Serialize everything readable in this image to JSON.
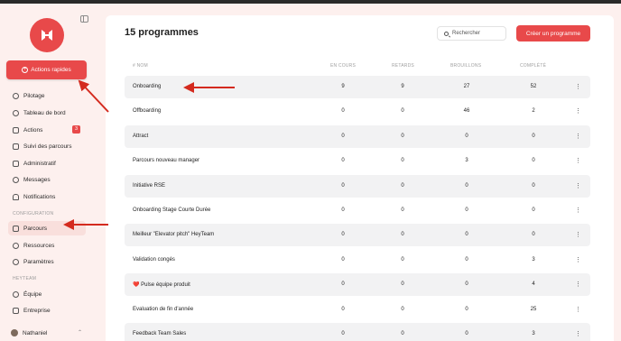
{
  "sidebar": {
    "quick_actions_label": "Actions rapides",
    "nav": [
      {
        "label": "Pilotage",
        "icon": "gauge-icon"
      },
      {
        "label": "Tableau de bord",
        "icon": "dashboard-icon"
      },
      {
        "label": "Actions",
        "icon": "lightning-icon",
        "badge": "3"
      },
      {
        "label": "Suivi des parcours",
        "icon": "route-icon"
      },
      {
        "label": "Administratif",
        "icon": "folder-icon"
      },
      {
        "label": "Messages",
        "icon": "message-icon"
      },
      {
        "label": "Notifications",
        "icon": "bell-icon"
      }
    ],
    "config_section": "CONFIGURATION",
    "config_items": [
      {
        "label": "Parcours",
        "icon": "checklist-icon",
        "active": true
      },
      {
        "label": "Ressources",
        "icon": "database-icon"
      },
      {
        "label": "Paramètres",
        "icon": "gear-icon"
      }
    ],
    "team_section": "HEYTEAM",
    "team_items": [
      {
        "label": "Équipe",
        "icon": "person-icon"
      },
      {
        "label": "Entreprise",
        "icon": "building-icon"
      }
    ],
    "user_name": "Nathaniel"
  },
  "main": {
    "title": "15 programmes",
    "search_placeholder": "Rechercher",
    "create_label": "Créer un programme",
    "columns": {
      "name": "# NOM",
      "en_cours": "EN COURS",
      "retards": "RETARDS",
      "brouillons": "BROUILLONS",
      "complete": "COMPLÉTÉ"
    },
    "rows": [
      {
        "name": "Onboarding",
        "en_cours": "9",
        "retards": "9",
        "brouillons": "27",
        "complete": "52"
      },
      {
        "name": "Offboarding",
        "en_cours": "0",
        "retards": "0",
        "brouillons": "46",
        "complete": "2"
      },
      {
        "name": "Attract",
        "en_cours": "0",
        "retards": "0",
        "brouillons": "0",
        "complete": "0"
      },
      {
        "name": "Parcours nouveau manager",
        "en_cours": "0",
        "retards": "0",
        "brouillons": "3",
        "complete": "0"
      },
      {
        "name": "Initiative RSE",
        "en_cours": "0",
        "retards": "0",
        "brouillons": "0",
        "complete": "0"
      },
      {
        "name": "Onboarding Stage Courte Durée",
        "en_cours": "0",
        "retards": "0",
        "brouillons": "0",
        "complete": "0"
      },
      {
        "name": "Meilleur \"Elevator pitch\" HeyTeam",
        "en_cours": "0",
        "retards": "0",
        "brouillons": "0",
        "complete": "0"
      },
      {
        "name": "Validation congés",
        "en_cours": "0",
        "retards": "0",
        "brouillons": "0",
        "complete": "3"
      },
      {
        "name": "❤️ Pulse équipe produit",
        "en_cours": "0",
        "retards": "0",
        "brouillons": "0",
        "complete": "4"
      },
      {
        "name": "Evaluation de fin d'année",
        "en_cours": "0",
        "retards": "0",
        "brouillons": "0",
        "complete": "25"
      },
      {
        "name": "Feedback Team Sales",
        "en_cours": "0",
        "retards": "0",
        "brouillons": "0",
        "complete": "3"
      }
    ]
  },
  "colors": {
    "accent": "#e8494a",
    "row_shade": "#f2f2f3",
    "sidebar_bg": "#fdf0ee"
  }
}
